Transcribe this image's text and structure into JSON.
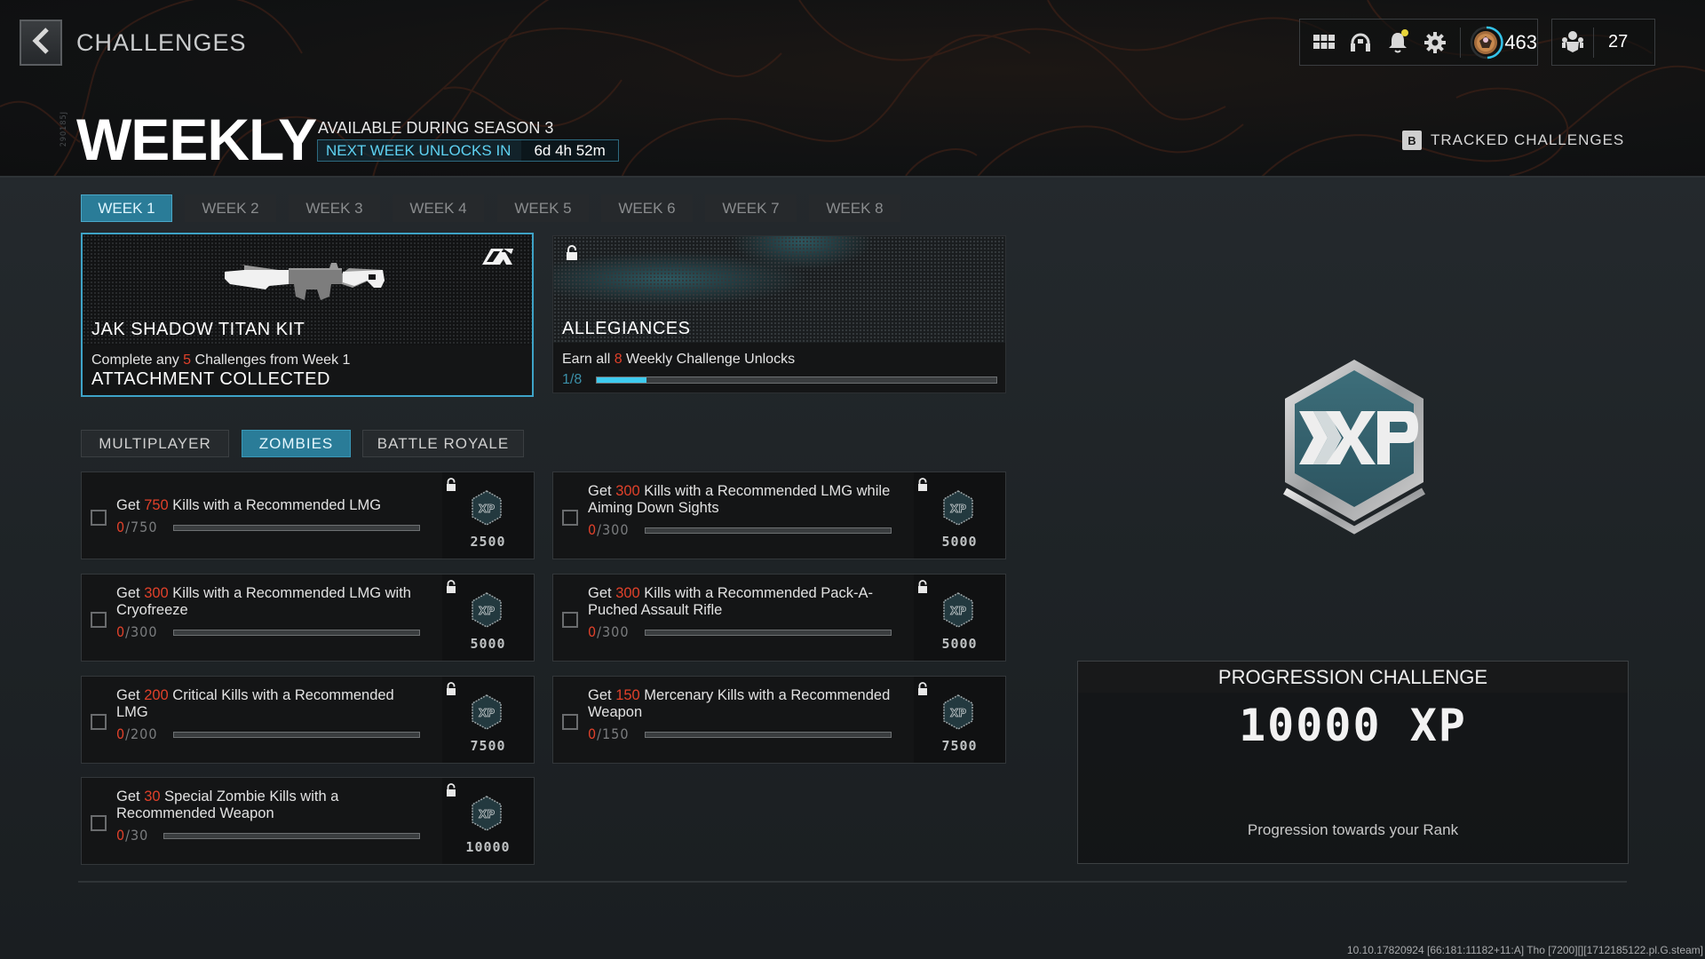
{
  "nav": {
    "back_label": "Back",
    "title": "CHALLENGES"
  },
  "header": {
    "vertical_code": "290185J",
    "title": "WEEKLY",
    "season": "AVAILABLE DURING SEASON 3",
    "unlock_label": "NEXT WEEK UNLOCKS IN",
    "unlock_time": "6d 4h 52m"
  },
  "status_bar": {
    "icons": [
      "apps-grid-icon",
      "headset-icon",
      "notification-bell-icon",
      "settings-gear-icon"
    ],
    "notification_dot_color": "#e8d43a",
    "rank_value": "463",
    "party_count": "27"
  },
  "tracked": {
    "key": "B",
    "label": "TRACKED CHALLENGES"
  },
  "weeks": {
    "active_index": 0,
    "tabs": [
      "WEEK 1",
      "WEEK 2",
      "WEEK 3",
      "WEEK 4",
      "WEEK 5",
      "WEEK 6",
      "WEEK 7",
      "WEEK 8"
    ]
  },
  "rewards": [
    {
      "name": "JAK SHADOW TITAN KIT",
      "desc_pre": "Complete any ",
      "desc_num": "5",
      "desc_post": " Challenges from Week 1",
      "status": "ATTACHMENT COLLECTED",
      "selected": true
    },
    {
      "name": "ALLEGIANCES",
      "desc_pre": "Earn all ",
      "desc_num": "8",
      "desc_post": " Weekly Challenge Unlocks",
      "progress_text": "1/8",
      "progress_current": 1,
      "progress_total": 8,
      "locked": true
    }
  ],
  "modes": {
    "active_index": 1,
    "tabs": [
      "MULTIPLAYER",
      "ZOMBIES",
      "BATTLE ROYALE"
    ]
  },
  "challenges": [
    {
      "pre": "Get ",
      "num": "750",
      "post": " Kills with a Recommended LMG",
      "current": "0",
      "total": "/750",
      "progress": 0,
      "xp": "2500",
      "locked": true,
      "checked": false
    },
    {
      "pre": "Get ",
      "num": "300",
      "post": " Kills with a Recommended LMG while Aiming Down Sights",
      "current": "0",
      "total": "/300",
      "progress": 0,
      "xp": "5000",
      "locked": true,
      "checked": false
    },
    {
      "pre": "Get ",
      "num": "300",
      "post": " Kills with a Recommended LMG with Cryofreeze",
      "current": "0",
      "total": "/300",
      "progress": 0,
      "xp": "5000",
      "locked": true,
      "checked": false
    },
    {
      "pre": "Get ",
      "num": "300",
      "post": " Kills with a Recommended Pack-A-Puched Assault Rifle",
      "current": "0",
      "total": "/300",
      "progress": 0,
      "xp": "5000",
      "locked": true,
      "checked": false
    },
    {
      "pre": "Get ",
      "num": "200",
      "post": " Critical Kills with a Recommended LMG",
      "current": "0",
      "total": "/200",
      "progress": 0,
      "xp": "7500",
      "locked": true,
      "checked": false
    },
    {
      "pre": "Get ",
      "num": "150",
      "post": " Mercenary Kills with a Recommended Weapon",
      "current": "0",
      "total": "/150",
      "progress": 0,
      "xp": "7500",
      "locked": true,
      "checked": false
    },
    {
      "pre": "Get ",
      "num": "30",
      "post": " Special Zombie Kills with a Recommended Weapon",
      "current": "0",
      "total": "/30",
      "progress": 0,
      "xp": "10000",
      "locked": true,
      "checked": false
    }
  ],
  "progression": {
    "badge_label": "XP",
    "heading": "PROGRESSION CHALLENGE",
    "xp": "10000 XP",
    "description": "Progression towards your Rank"
  },
  "build_info": "10.10.17820924 [66:181:11182+11:A] Tho [7200][][1712185122.pl.G.steam]",
  "colors": {
    "accent": "#2a7c98",
    "accent_text": "#5ed1f2",
    "highlight": "#e0412a",
    "progress_fill": "#3ecbef"
  }
}
